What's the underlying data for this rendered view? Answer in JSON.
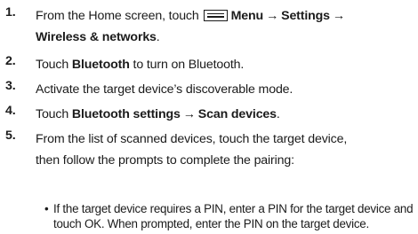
{
  "steps": [
    {
      "number": "1.",
      "text_before": "From the Home screen, touch",
      "icon": "menu-icon",
      "menu_label": "Menu",
      "settings_label": "Settings",
      "arrow": "→",
      "wireless_label": "Wireless & networks",
      "trailing": "."
    },
    {
      "number": "2.",
      "text_before": "Touch",
      "bluetooth_label": "Bluetooth",
      "text_after": "to turn on Bluetooth."
    },
    {
      "number": "3.",
      "text": "Activate the target device’s discoverable mode."
    },
    {
      "number": "4.",
      "text_before": "Touch",
      "bt_settings_label": "Bluetooth settings",
      "arrow": "→",
      "scan_label": "Scan devices",
      "trailing": "."
    },
    {
      "number": "5.",
      "line1": "From the list of scanned devices, touch the target device,",
      "line2": "then follow the prompts to complete the pairing:",
      "bullet": {
        "dot": "•",
        "text": "If the target device requires a PIN, enter a PIN for the target device and touch OK. When prompted, enter the PIN on the target device."
      }
    }
  ]
}
